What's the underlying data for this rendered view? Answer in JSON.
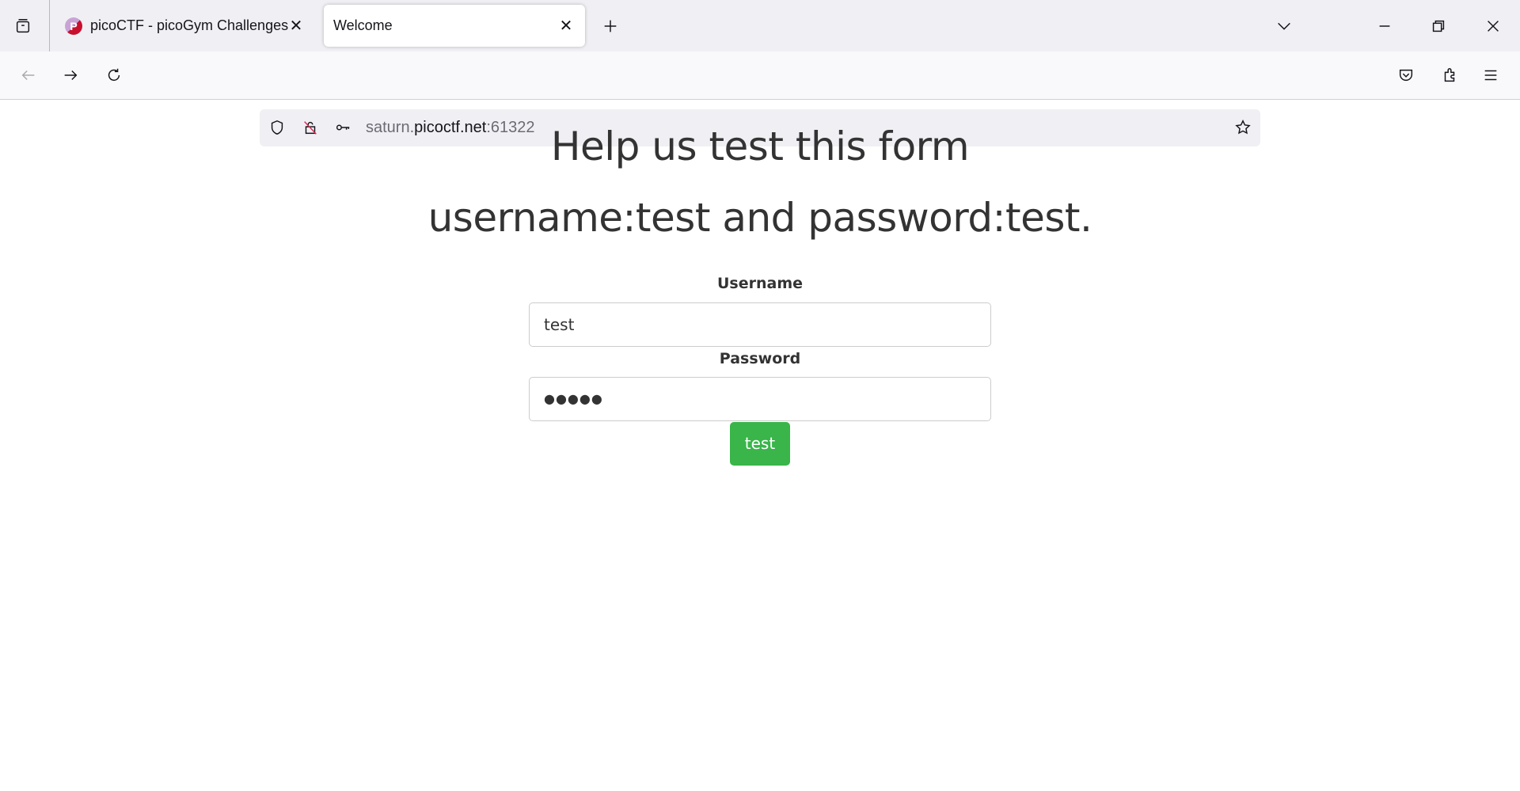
{
  "browser": {
    "tabs": [
      {
        "title": "picoCTF - picoGym Challenges",
        "favicon": "P",
        "active": false
      },
      {
        "title": "Welcome",
        "active": true
      }
    ],
    "url": {
      "prefix": "saturn.",
      "host": "picoctf.net",
      "port": ":61322"
    }
  },
  "page": {
    "heading": "Help us test this form",
    "subheading": "username:test and password:test.",
    "username_label": "Username",
    "username_value": "test",
    "password_label": "Password",
    "password_masked": "●●●●●",
    "submit_label": "test",
    "accent_color": "#39b54a"
  }
}
